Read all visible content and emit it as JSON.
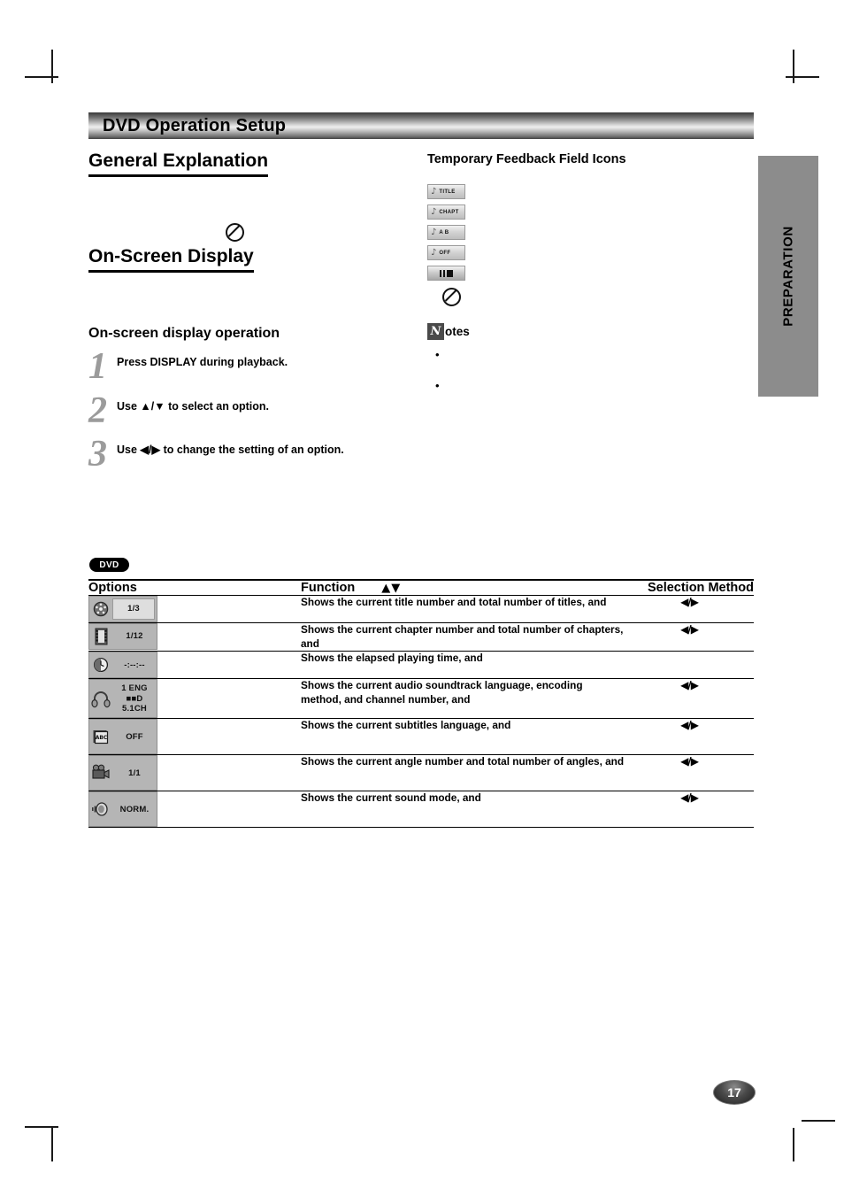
{
  "banner": {
    "title": "DVD Operation Setup"
  },
  "left": {
    "general_explanation": "General Explanation",
    "no_entry_icon": "no-entry-icon",
    "on_screen_display": "On-Screen Display",
    "subsection": "On-screen display operation",
    "steps": [
      {
        "num": "1",
        "text": "Press DISPLAY during playback."
      },
      {
        "num": "2",
        "text": "Use ▲/▼ to select an option."
      },
      {
        "num": "3",
        "text": "Use ◀/▶ to change the setting of an option."
      }
    ]
  },
  "right": {
    "title": "Temporary Feedback Field Icons",
    "icons": [
      {
        "glyph": "♪",
        "label": "TITLE"
      },
      {
        "glyph": "♪",
        "label": "CHAPT"
      },
      {
        "glyph": "♪",
        "label": "A  B"
      },
      {
        "glyph": "♪",
        "label": "OFF"
      },
      {
        "glyph": "",
        "label": "pause-icon"
      }
    ],
    "no_entry_icon": "no-entry-icon",
    "notes": {
      "badge": "N",
      "label": "otes",
      "bullets": [
        "",
        ""
      ]
    }
  },
  "side_tab": {
    "label": "PREPARATION"
  },
  "table": {
    "badge": "DVD",
    "headers": {
      "options": "Options",
      "function": "Function",
      "function_arrows": "▲▼",
      "selection": "Selection Method"
    },
    "rows": [
      {
        "icon": "title-disc-icon",
        "value": "1/3",
        "function": "Shows the current title number and total number of titles, and",
        "selection": "◀/▶"
      },
      {
        "icon": "chapter-film-icon",
        "value": "1/12",
        "function": "Shows the current chapter number and total number of chapters, and",
        "selection": "◀/▶"
      },
      {
        "icon": "time-clock-icon",
        "value": "-:--:--",
        "function": "Shows the elapsed playing time, and",
        "selection": ""
      },
      {
        "icon": "audio-headphones-icon",
        "value": "1  ENG\n■■D\n5.1CH",
        "function": "Shows the current audio soundtrack language, encoding method, and channel number, and",
        "selection": "◀/▶"
      },
      {
        "icon": "subtitle-abc-icon",
        "value": "OFF",
        "function": "Shows the current subtitles language, and",
        "selection": "◀/▶"
      },
      {
        "icon": "angle-camera-icon",
        "value": "1/1",
        "function": "Shows the current angle number and total number of angles, and",
        "selection": "◀/▶"
      },
      {
        "icon": "sound-mode-icon",
        "value": "NORM.",
        "function": "Shows the current sound mode, and",
        "selection": "◀/▶"
      }
    ]
  },
  "page_number": "17"
}
